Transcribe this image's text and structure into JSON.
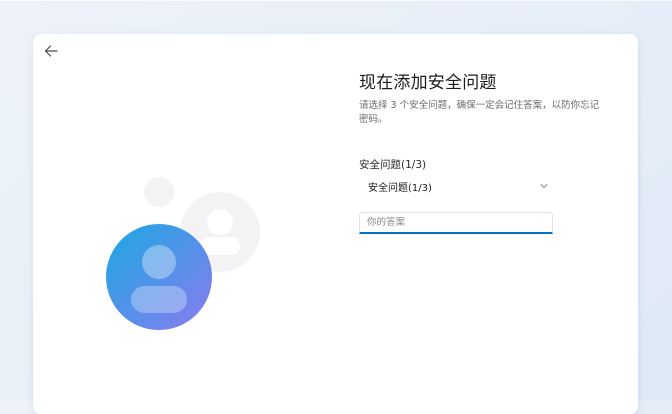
{
  "header": {
    "back_icon": "back-arrow-icon"
  },
  "main": {
    "title": "现在添加安全问题",
    "subtitle": "请选择 3 个安全问题，确保一定会记住答案，以防你忘记密码。",
    "question1": {
      "label": "安全问题(1/3)",
      "selected": "安全问题(1/3)",
      "chevron_icon": "chevron-down-icon"
    },
    "answer1": {
      "placeholder": "你的答案",
      "value": ""
    }
  },
  "illustration": {
    "icon": "user-avatar-icon",
    "colors": {
      "gradient_start": "#1aa9e3",
      "gradient_end": "#8a7bef",
      "ghost": "#f2f2f4",
      "accent": "#0a70c4"
    }
  }
}
